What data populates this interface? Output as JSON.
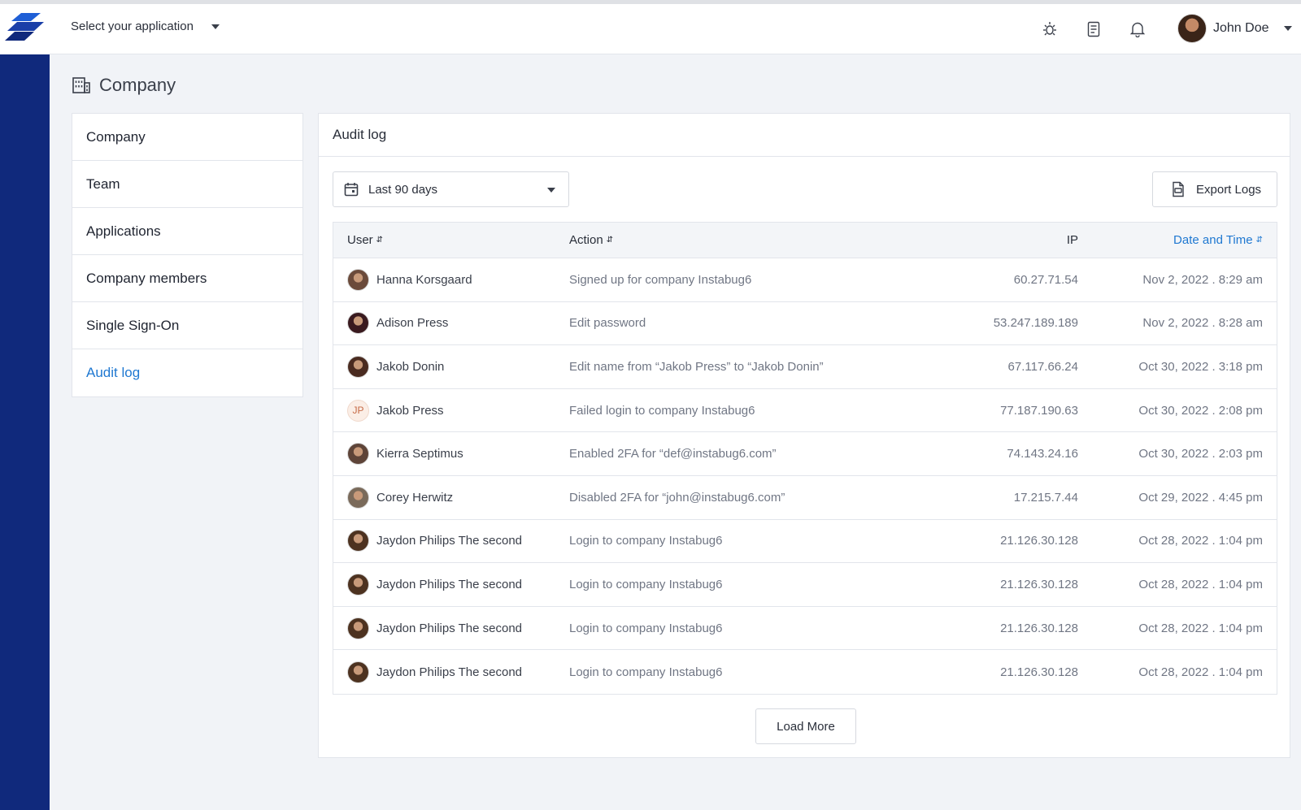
{
  "topbar": {
    "app_selector": "Select your application",
    "user_name": "John Doe",
    "icons": [
      "bug-icon",
      "document-icon",
      "bell-icon"
    ]
  },
  "page": {
    "title": "Company"
  },
  "subnav": {
    "items": [
      {
        "label": "Company"
      },
      {
        "label": "Team"
      },
      {
        "label": "Applications"
      },
      {
        "label": "Company members"
      },
      {
        "label": "Single Sign-On"
      },
      {
        "label": "Audit log"
      }
    ],
    "active": "Audit log"
  },
  "audit": {
    "title": "Audit log",
    "date_filter": "Last 90 days",
    "export_label": "Export Logs",
    "load_more": "Load More",
    "columns": {
      "user": "User",
      "action": "Action",
      "ip": "IP",
      "date": "Date and Time"
    },
    "rows": [
      {
        "user": "Hanna Korsgaard",
        "action": "Signed up for company Instabug6",
        "ip": "60.27.71.54",
        "date": "Nov 2, 2022 . 8:29 am",
        "avatar": "#6b4a3a"
      },
      {
        "user": "Adison Press",
        "action": "Edit password",
        "ip": "53.247.189.189",
        "date": "Nov 2, 2022 . 8:28 am",
        "avatar": "#3a1a1f"
      },
      {
        "user": "Jakob Donin",
        "action": "Edit name from “Jakob Press” to “Jakob Donin”",
        "ip": "67.117.66.24",
        "date": "Oct 30, 2022 . 3:18 pm",
        "avatar": "#4a2b20"
      },
      {
        "user": "Jakob Press",
        "action": "Failed login to company Instabug6",
        "ip": "77.187.190.63",
        "date": "Oct 30, 2022 . 2:08 pm",
        "initials": "JP"
      },
      {
        "user": "Kierra Septimus",
        "action": "Enabled 2FA for “def@instabug6.com”",
        "ip": "74.143.24.16",
        "date": "Oct 30, 2022 . 2:03 pm",
        "avatar": "#5e4438"
      },
      {
        "user": "Corey Herwitz",
        "action": "Disabled 2FA for “john@instabug6.com”",
        "ip": "17.215.7.44",
        "date": "Oct 29, 2022 . 4:45 pm",
        "avatar": "#7a6a5a"
      },
      {
        "user": "Jaydon Philips The second",
        "action": "Login to company Instabug6",
        "ip": "21.126.30.128",
        "date": "Oct 28, 2022 . 1:04 pm",
        "avatar": "#4d3220"
      },
      {
        "user": "Jaydon Philips The second",
        "action": "Login to company Instabug6",
        "ip": "21.126.30.128",
        "date": "Oct 28, 2022 . 1:04 pm",
        "avatar": "#4d3220"
      },
      {
        "user": "Jaydon Philips The second",
        "action": "Login to company Instabug6",
        "ip": "21.126.30.128",
        "date": "Oct 28, 2022 . 1:04 pm",
        "avatar": "#4d3220"
      },
      {
        "user": "Jaydon Philips The second",
        "action": "Login to company Instabug6",
        "ip": "21.126.30.128",
        "date": "Oct 28, 2022 . 1:04 pm",
        "avatar": "#4d3220"
      }
    ]
  },
  "colors": {
    "accent": "#1f78d1",
    "rail": "#10297c"
  }
}
